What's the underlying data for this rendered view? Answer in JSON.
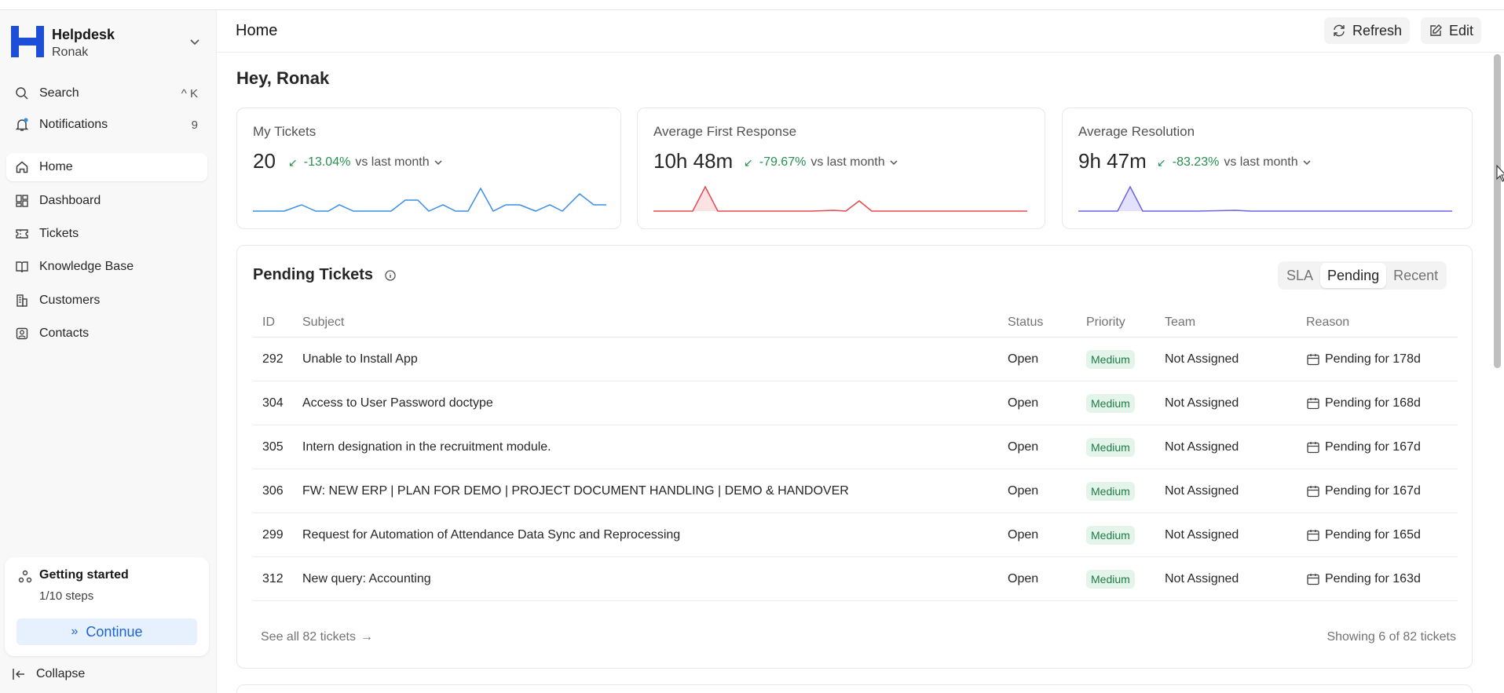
{
  "brand": {
    "title": "Helpdesk",
    "user": "Ronak",
    "logo_color": "#1d4ed8"
  },
  "sidebar": {
    "search": {
      "label": "Search",
      "shortcut": "^ K"
    },
    "notifications": {
      "label": "Notifications",
      "count": "9"
    },
    "items": [
      {
        "label": "Home",
        "icon": "home-icon",
        "active": true
      },
      {
        "label": "Dashboard",
        "icon": "dashboard-icon"
      },
      {
        "label": "Tickets",
        "icon": "ticket-icon"
      },
      {
        "label": "Knowledge Base",
        "icon": "book-icon"
      },
      {
        "label": "Customers",
        "icon": "building-icon"
      },
      {
        "label": "Contacts",
        "icon": "contact-icon"
      }
    ],
    "getting_started": {
      "title": "Getting started",
      "steps": "1/10 steps",
      "button": "Continue"
    },
    "collapse": "Collapse"
  },
  "header": {
    "title": "Home",
    "refresh": "Refresh",
    "edit": "Edit"
  },
  "greeting": "Hey, Ronak",
  "metrics": [
    {
      "label": "My Tickets",
      "value": "20",
      "delta": "-13.04%",
      "vs": "vs last month",
      "color": "#3b8ee8"
    },
    {
      "label": "Average First Response",
      "value": "10h 48m",
      "delta": "-79.67%",
      "vs": "vs last month",
      "color": "#e5484d"
    },
    {
      "label": "Average Resolution",
      "value": "9h 47m",
      "delta": "-83.23%",
      "vs": "vs last month",
      "color": "#6b63e6"
    }
  ],
  "pending": {
    "title": "Pending Tickets",
    "tabs": [
      "SLA",
      "Pending",
      "Recent"
    ],
    "selected_tab": "Pending",
    "columns": [
      "ID",
      "Subject",
      "Status",
      "Priority",
      "Team",
      "Reason"
    ],
    "rows": [
      {
        "id": "292",
        "subject": "Unable to Install App",
        "status": "Open",
        "priority": "Medium",
        "team": "Not Assigned",
        "reason": "Pending for 178d"
      },
      {
        "id": "304",
        "subject": "Access to User Password doctype",
        "status": "Open",
        "priority": "Medium",
        "team": "Not Assigned",
        "reason": "Pending for 168d"
      },
      {
        "id": "305",
        "subject": "Intern designation in the recruitment module.",
        "status": "Open",
        "priority": "Medium",
        "team": "Not Assigned",
        "reason": "Pending for 167d"
      },
      {
        "id": "306",
        "subject": "FW: NEW ERP | PLAN FOR DEMO | PROJECT DOCUMENT HANDLING | DEMO & HANDOVER",
        "status": "Open",
        "priority": "Medium",
        "team": "Not Assigned",
        "reason": "Pending for 167d"
      },
      {
        "id": "299",
        "subject": "Request for Automation of Attendance Data Sync and Reprocessing",
        "status": "Open",
        "priority": "Medium",
        "team": "Not Assigned",
        "reason": "Pending for 165d"
      },
      {
        "id": "312",
        "subject": "New query: Accounting",
        "status": "Open",
        "priority": "Medium",
        "team": "Not Assigned",
        "reason": "Pending for 163d"
      }
    ],
    "see_all": "See all 82 tickets",
    "showing": "Showing 6 of 82 tickets"
  }
}
